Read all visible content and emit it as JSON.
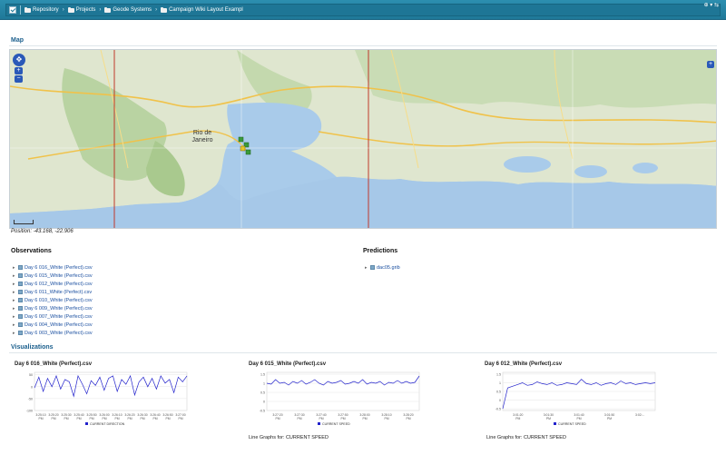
{
  "toolbar": {
    "breadcrumbs": [
      "Repository",
      "Projects",
      "Geode Systems",
      "Campaign Wiki Layout Exampl"
    ],
    "right_icons": "⊕ ▾ ⇆"
  },
  "map_section": {
    "title": "Map",
    "pan_symbol": "✥",
    "zoom_in": "+",
    "zoom_out": "−",
    "layer_symbol": "+",
    "city_label": "Rio de Janeiro",
    "position_label": "Position:",
    "position_value": "-43.168, -22.906"
  },
  "observations": {
    "title": "Observations",
    "items": [
      "Day 6 016_White (Perfect).csv",
      "Day 6 015_White (Perfect).csv",
      "Day 6 012_White (Perfect).csv",
      "Day 6 011_White (Perfect).csv",
      "Day 6 010_White (Perfect).csv",
      "Day 6 009_White (Perfect).csv",
      "Day 6 007_White (Perfect).csv",
      "Day 6 004_White (Perfect).csv",
      "Day 6 003_White (Perfect).csv"
    ]
  },
  "predictions": {
    "title": "Predictions",
    "items": [
      "dac05.grib"
    ]
  },
  "visualizations": {
    "title": "Visualizations",
    "charts": [
      {
        "title": "Day 6 016_White (Perfect).csv",
        "legend": "CURRENT DIRECTION",
        "footer": ""
      },
      {
        "title": "Day 6 015_White (Perfect).csv",
        "legend": "CURRENT SPEED",
        "footer": "Line Graphs for: CURRENT SPEED"
      },
      {
        "title": "Day 6 012_White (Perfect).csv",
        "legend": "CURRENT SPEED",
        "footer": "Line Graphs for: CURRENT SPEED"
      }
    ]
  },
  "chart_data": [
    {
      "type": "line",
      "title": "Day 6 016_White (Perfect).csv",
      "series": [
        {
          "name": "CURRENT DIRECTION",
          "values": [
            -5,
            40,
            -20,
            35,
            0,
            45,
            -10,
            30,
            20,
            -40,
            45,
            10,
            -30,
            25,
            5,
            40,
            -15,
            35,
            45,
            -20,
            30,
            10,
            45,
            -35,
            20,
            40,
            0,
            35,
            -10,
            45,
            15,
            30,
            -25,
            40,
            20,
            45
          ]
        }
      ],
      "x": [
        "3:25:10 PM",
        "3:25:20 PM",
        "3:25:30 PM",
        "3:25:40 PM",
        "3:25:50 PM",
        "3:26:00 PM",
        "3:26:10 PM",
        "3:26:20 PM",
        "3:26:30 PM",
        "3:26:40 PM",
        "3:26:50 PM",
        "3:27:00 PM"
      ],
      "yticks": [
        50,
        0,
        -50,
        -100
      ],
      "ylim": [
        -100,
        60
      ],
      "color": "#2222cc"
    },
    {
      "type": "line",
      "title": "Day 6 015_White (Perfect).csv",
      "series": [
        {
          "name": "CURRENT SPEED",
          "values": [
            1.0,
            0.95,
            1.2,
            1.0,
            1.05,
            0.9,
            1.1,
            1.0,
            1.15,
            0.95,
            1.05,
            1.2,
            1.0,
            0.9,
            1.1,
            1.0,
            1.05,
            1.15,
            0.95,
            1.0,
            1.1,
            1.0,
            1.2,
            0.95,
            1.05,
            1.0,
            1.1,
            0.9,
            1.05,
            1.0,
            1.15,
            1.0,
            1.1,
            1.0,
            1.05,
            1.4
          ]
        }
      ],
      "x": [
        "3:27:20 PM",
        "3:27:30 PM",
        "3:27:40 PM",
        "3:27:50 PM",
        "3:28:00 PM",
        "3:28:10 PM",
        "3:28:20 PM"
      ],
      "yticks": [
        1.5,
        1.0,
        0.5,
        0.0,
        -0.5
      ],
      "ylim": [
        -0.5,
        1.6
      ],
      "color": "#2222cc"
    },
    {
      "type": "line",
      "title": "Day 6 012_White (Perfect).csv",
      "series": [
        {
          "name": "CURRENT SPEED",
          "values": [
            -0.5,
            0.7,
            0.8,
            0.9,
            1.0,
            0.85,
            0.9,
            1.05,
            0.95,
            0.9,
            1.0,
            0.85,
            0.9,
            1.0,
            0.95,
            0.9,
            1.2,
            0.95,
            0.9,
            1.0,
            0.85,
            0.95,
            1.0,
            0.9,
            1.1,
            0.95,
            1.0,
            0.9,
            0.95,
            1.0,
            0.95,
            1.0
          ]
        }
      ],
      "x": [
        "3:01:20 PM",
        "3:01:30 PM",
        "3:01:40 PM",
        "3:01:50 PM",
        "3:02:..."
      ],
      "yticks": [
        1.5,
        1.0,
        0.5,
        0.0,
        -0.5
      ],
      "ylim": [
        -0.6,
        1.6
      ],
      "color": "#2222cc"
    }
  ]
}
